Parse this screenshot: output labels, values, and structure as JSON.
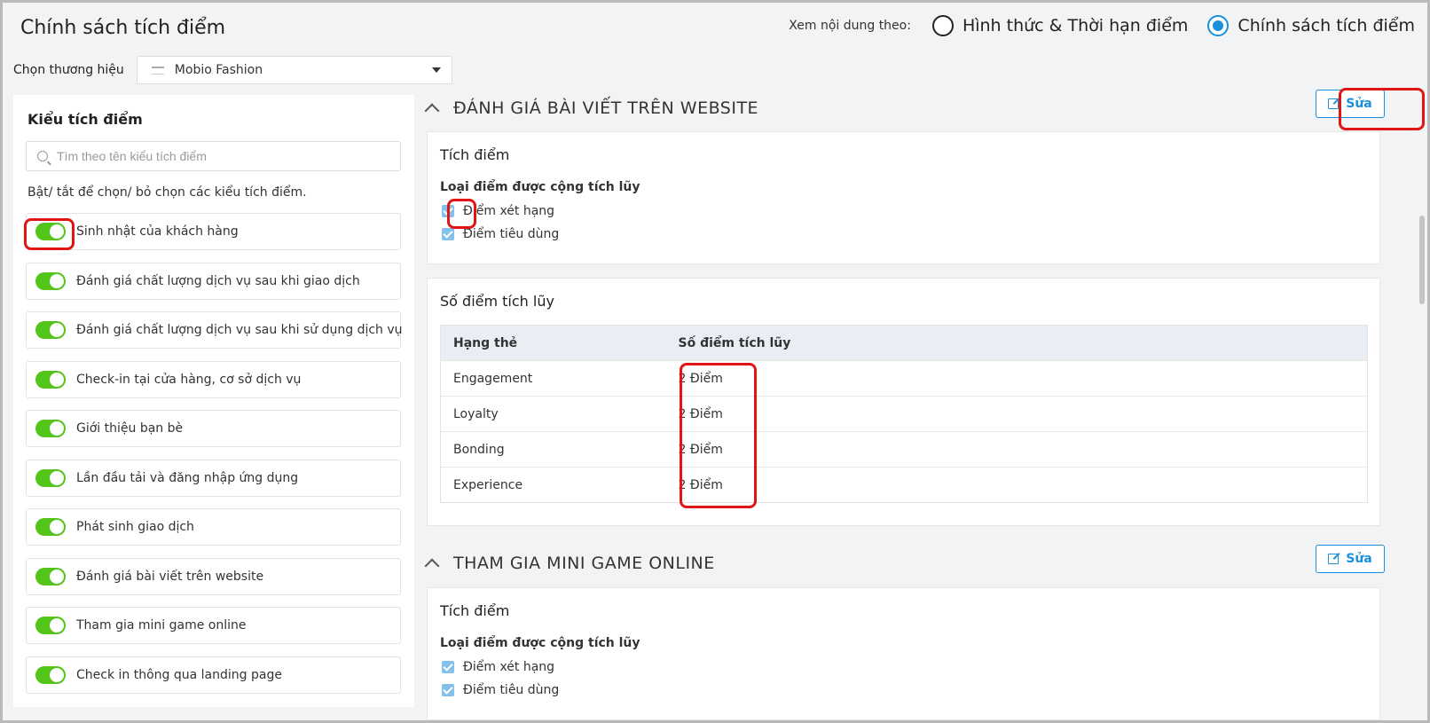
{
  "header": {
    "title": "Chính sách tích điểm",
    "view_label": "Xem nội dung theo:",
    "options": [
      {
        "label": "Hình thức & Thời hạn điểm",
        "selected": false
      },
      {
        "label": "Chính sách tích điểm",
        "selected": true
      }
    ]
  },
  "brand": {
    "label": "Chọn thương hiệu",
    "value": "Mobio Fashion"
  },
  "left_panel": {
    "title": "Kiểu tích điểm",
    "search_placeholder": "Tìm theo tên kiểu tích điểm",
    "hint": "Bật/ tắt để chọn/ bỏ chọn các kiểu tích điểm.",
    "items": [
      {
        "label": "Sinh nhật của khách hàng",
        "on": true
      },
      {
        "label": "Đánh giá chất lượng dịch vụ sau khi giao dịch",
        "on": true
      },
      {
        "label": "Đánh giá chất lượng dịch vụ sau khi sử dụng dịch vụ",
        "on": true
      },
      {
        "label": "Check-in tại cửa hàng, cơ sở dịch vụ",
        "on": true
      },
      {
        "label": "Giới thiệu bạn bè",
        "on": true
      },
      {
        "label": "Lần đầu tải và đăng nhập ứng dụng",
        "on": true
      },
      {
        "label": "Phát sinh giao dịch",
        "on": true
      },
      {
        "label": "Đánh giá bài viết trên website",
        "on": true
      },
      {
        "label": "Tham gia mini game online",
        "on": true
      },
      {
        "label": "Check in thông qua landing page",
        "on": true
      }
    ]
  },
  "section1": {
    "title": "ĐÁNH GIÁ BÀI VIẾT TRÊN WEBSITE",
    "edit_label": "Sửa",
    "card_title": "Tích điểm",
    "points_type_label": "Loại điểm được cộng tích lũy",
    "checkboxes": [
      "Điểm xét hạng",
      "Điểm tiêu dùng"
    ],
    "table_title": "Số điểm tích lũy",
    "table_headers": [
      "Hạng thẻ",
      "Số điểm tích lũy"
    ],
    "rows": [
      [
        "Engagement",
        "2 Điểm"
      ],
      [
        "Loyalty",
        "2 Điểm"
      ],
      [
        "Bonding",
        "2 Điểm"
      ],
      [
        "Experience",
        "2 Điểm"
      ]
    ]
  },
  "section2": {
    "title": "THAM GIA MINI GAME ONLINE",
    "edit_label": "Sửa",
    "card_title": "Tích điểm",
    "points_type_label": "Loại điểm được cộng tích lũy",
    "checkboxes": [
      "Điểm xét hạng",
      "Điểm tiêu dùng"
    ]
  },
  "colors": {
    "accent": "#1a8fdc",
    "toggle_on": "#52c41a",
    "highlight": "#e01616"
  }
}
